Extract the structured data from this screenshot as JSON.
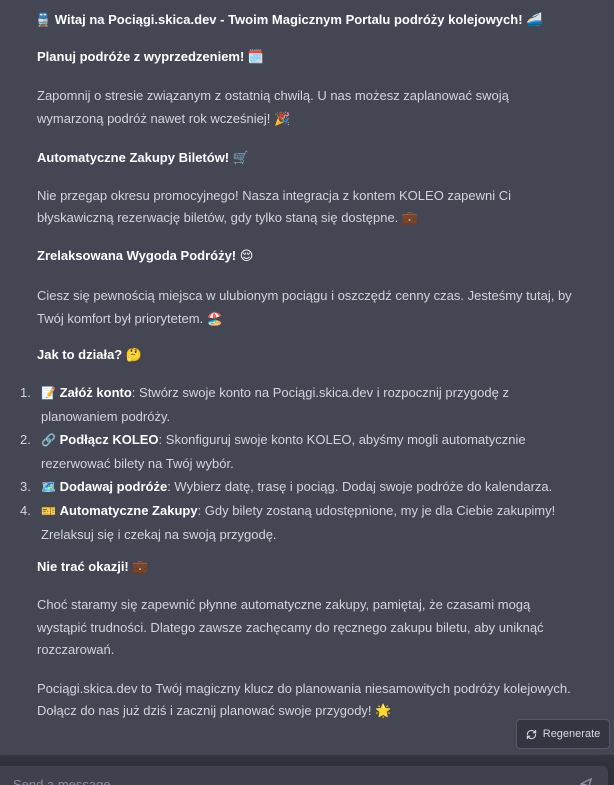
{
  "message": {
    "title": "🚆 Witaj na Pociągi.skica.dev - Twoim Magicznym Portalu podróży kolejowych! 🚄",
    "sections": [
      {
        "heading": "Planuj podróże z wyprzedzeniem! 🗓️",
        "lines": [
          "Zapomnij o stresie związanym z ostatnią chwilą. U nas możesz zaplanować swoją",
          "wymarzoną podróż nawet rok wcześniej! 🎉"
        ]
      },
      {
        "heading": "Automatyczne Zakupy Biletów! 🛒",
        "lines": [
          "Nie przegap okresu promocyjnego! Nasza integracja z kontem KOLEO zapewni Ci",
          "błyskawiczną rezerwację biletów, gdy tylko staną się dostępne. 💼"
        ]
      },
      {
        "heading": "Zrelaksowana Wygoda Podróży! 😌",
        "lines": [
          "Ciesz się pewnością miejsca w ulubionym pociągu i oszczędź cenny czas. Jesteśmy tutaj, by",
          "Twój komfort był priorytetem. 🏖️"
        ]
      },
      {
        "heading": "Jak to działa? 🤔"
      }
    ],
    "steps": [
      {
        "num": "1.",
        "icon": "📝",
        "bold": "Załóż konto",
        "line1": ": Stwórz swoje konto na Pociągi.skica.dev i rozpocznij przygodę z",
        "line2": "planowaniem podróży."
      },
      {
        "num": "2.",
        "icon": "🔗",
        "bold": "Podłącz KOLEO",
        "line1": ": Skonfiguruj swoje konto KOLEO, abyśmy mogli automatycznie",
        "line2": "rezerwować bilety na Twój wybór."
      },
      {
        "num": "3.",
        "icon": "🗺️",
        "bold": "Dodawaj podróże",
        "line1": ": Wybierz datę, trasę i pociąg. Dodaj swoje podróże do kalendarza.",
        "line2": ""
      },
      {
        "num": "4.",
        "icon": "🎫",
        "bold": "Automatyczne Zakupy",
        "line1": ": Gdy bilety zostaną udostępnione, my je dla Ciebie zakupimy!",
        "line2": "Zrelaksuj się i czekaj na swoją przygodę."
      }
    ],
    "closing": {
      "heading": "Nie trać okazji! 💼",
      "para1": [
        "Choć staramy się zapewnić płynne automatyczne zakupy, pamiętaj, że czasami mogą",
        "wystąpić trudności. Dlatego zawsze zachęcamy do ręcznego zakupu biletu, aby uniknąć",
        "rozczarowań."
      ],
      "para2": [
        "Pociągi.skica.dev to Twój magiczny klucz do planowania niesamowitych podróży kolejowych.",
        "Dołącz do nas już dziś i zacznij planować swoje przygody! 🌟"
      ]
    }
  },
  "regenerate": {
    "label": "Regenerate",
    "icon": "refresh-icon"
  },
  "composer": {
    "placeholder": "Send a message",
    "send_icon": "send-icon"
  },
  "colors": {
    "background": "#444654",
    "text": "#d1d5db",
    "heading": "#ffffff",
    "input_bg": "#40414f"
  }
}
